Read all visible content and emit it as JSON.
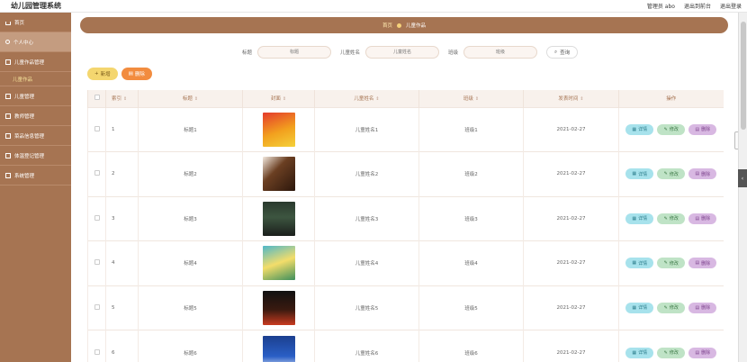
{
  "app": {
    "title": "幼儿园管理系统"
  },
  "header": {
    "user_label": "管理员 abo",
    "front_link": "退出到前台",
    "logout_link": "退出登录"
  },
  "sidebar": {
    "items": [
      {
        "label": "首页",
        "icon": "home-icon"
      },
      {
        "label": "个人中心",
        "icon": "user-icon",
        "active": true
      },
      {
        "label": "儿童作品管理",
        "icon": "grid-icon"
      },
      {
        "label": "儿童作品",
        "sub": true
      },
      {
        "label": "儿童管理",
        "icon": "grid-icon"
      },
      {
        "label": "教师管理",
        "icon": "grid-icon"
      },
      {
        "label": "菜品信息管理",
        "icon": "grid-icon"
      },
      {
        "label": "体温登记管理",
        "icon": "grid-icon"
      },
      {
        "label": "系统管理",
        "icon": "grid-icon"
      }
    ]
  },
  "breadcrumb": {
    "home": "首页",
    "current": "儿童作品"
  },
  "search": {
    "title_label": "标题",
    "title_placeholder": "标题",
    "child_label": "儿童姓名",
    "child_placeholder": "儿童姓名",
    "class_label": "班级",
    "class_placeholder": "班级",
    "button_label": "查询"
  },
  "actions": {
    "add_label": "新增",
    "delete_label": "删除"
  },
  "table": {
    "headers": [
      "",
      "索引",
      "标题",
      "封面",
      "儿童姓名",
      "班级",
      "发表时间",
      "操作"
    ],
    "row_buttons": {
      "detail": "详情",
      "edit": "修改",
      "delete": "删除"
    },
    "rows": [
      {
        "index": "1",
        "title": "标题1",
        "child": "儿童姓名1",
        "class": "班级1",
        "date": "2021-02-27"
      },
      {
        "index": "2",
        "title": "标题2",
        "child": "儿童姓名2",
        "class": "班级2",
        "date": "2021-02-27"
      },
      {
        "index": "3",
        "title": "标题3",
        "child": "儿童姓名3",
        "class": "班级3",
        "date": "2021-02-27"
      },
      {
        "index": "4",
        "title": "标题4",
        "child": "儿童姓名4",
        "class": "班级4",
        "date": "2021-02-27"
      },
      {
        "index": "5",
        "title": "标题5",
        "child": "儿童姓名5",
        "class": "班级5",
        "date": "2021-02-27"
      },
      {
        "index": "6",
        "title": "标题6",
        "child": "儿童姓名6",
        "class": "班级6",
        "date": "2021-02-27"
      }
    ]
  },
  "colors": {
    "sidebar": "#a67452",
    "accent_yellow": "#f4d66f",
    "accent_orange": "#f28c3f"
  }
}
